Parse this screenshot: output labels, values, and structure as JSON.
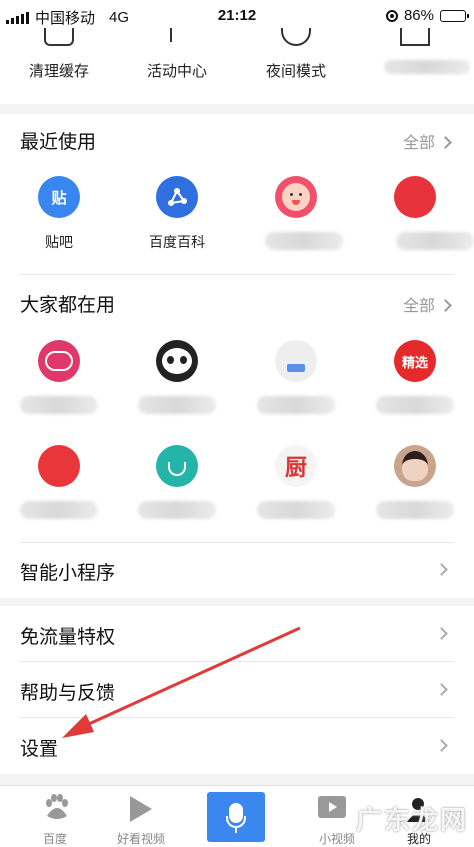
{
  "status": {
    "carrier": "中国移动",
    "network": "4G",
    "time": "21:12",
    "battery": "86%",
    "battery_level": 0.86
  },
  "tools": [
    {
      "label": "清理缓存",
      "icon": "trash-icon"
    },
    {
      "label": "活动中心",
      "icon": "flag-icon"
    },
    {
      "label": "夜间模式",
      "icon": "moon-icon"
    },
    {
      "label": "",
      "icon": "grid-icon"
    }
  ],
  "recent": {
    "title": "最近使用",
    "more": "全部",
    "apps": [
      {
        "name": "贴吧",
        "icon_text": "贴",
        "color": "#3a86f0"
      },
      {
        "name": "百度百科",
        "icon_text": "",
        "color": "#2f6fe0"
      },
      {
        "name": "",
        "icon_text": "",
        "color": "#f0506a"
      },
      {
        "name": "",
        "icon_text": "",
        "color": "#e8333c"
      }
    ]
  },
  "popular": {
    "title": "大家都在用",
    "more": "全部",
    "apps": [
      {
        "name": "",
        "icon_text": "",
        "color": "#e0386a"
      },
      {
        "name": "",
        "icon_text": "",
        "color": "#222222"
      },
      {
        "name": "",
        "icon_text": "",
        "color": "#eeeeee"
      },
      {
        "name": "",
        "icon_text": "精选",
        "color": "#e42a2a"
      },
      {
        "name": "",
        "icon_text": "",
        "color": "#e8363b"
      },
      {
        "name": "",
        "icon_text": "",
        "color": "#25b5a8"
      },
      {
        "name": "",
        "icon_text": "厨",
        "color": "#f4f4f4"
      },
      {
        "name": "",
        "icon_text": "",
        "color": "#c9a48c"
      }
    ]
  },
  "mini_program": "智能小程序",
  "menu": [
    "免流量特权",
    "帮助与反馈",
    "设置"
  ],
  "tabs": [
    {
      "label": "百度",
      "icon": "baidu-paw-icon"
    },
    {
      "label": "好看视频",
      "icon": "play-icon"
    },
    {
      "label": "",
      "icon": "microphone-icon"
    },
    {
      "label": "小视频",
      "icon": "video-icon"
    },
    {
      "label": "我的",
      "icon": "profile-icon"
    }
  ],
  "watermark": "广东龙网"
}
